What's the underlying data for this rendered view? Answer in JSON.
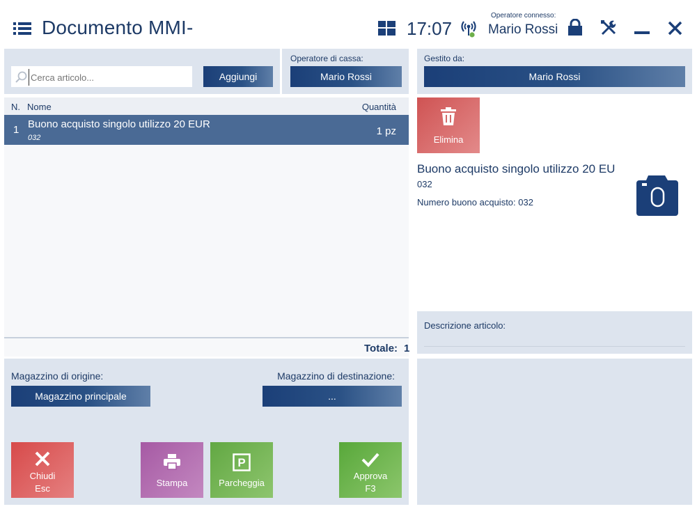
{
  "header": {
    "title": "Documento MMI-",
    "time": "17:07",
    "operator_caption": "Operatore connesso:",
    "operator_name": "Mario Rossi"
  },
  "search": {
    "placeholder": "Cerca articolo...",
    "add_label": "Aggiungi"
  },
  "cashier": {
    "label": "Operatore di cassa:",
    "value": "Mario Rossi"
  },
  "managed_by": {
    "label": "Gestito da:",
    "value": "Mario Rossi"
  },
  "table": {
    "col_n": "N.",
    "col_name": "Nome",
    "col_qty": "Quantità",
    "rows": [
      {
        "n": "1",
        "name": "Buono acquisto singolo utilizzo 20 EUR",
        "code": "032",
        "qty": "1 pz"
      }
    ],
    "total_label": "Totale:",
    "total_value": "1"
  },
  "warehouse": {
    "origin_label": "Magazzino di origine:",
    "origin_value": "Magazzino principale",
    "dest_label": "Magazzino di destinazione:",
    "dest_value": "..."
  },
  "actions": {
    "close_label": "Chiudi",
    "close_key": "Esc",
    "print_label": "Stampa",
    "park_label": "Parcheggia",
    "approve_label": "Approva",
    "approve_key": "F3"
  },
  "details": {
    "delete_label": "Elimina",
    "item_name": "Buono acquisto singolo utilizzo 20 EU",
    "item_code": "032",
    "voucher_label": "Numero buono acquisto: 032",
    "description_label": "Descrizione articolo:"
  },
  "colors": {
    "accent": "#1b3f78",
    "panel": "#dde4ee",
    "selected_row": "#4a6a95",
    "delete": "#d35b5b",
    "print": "#a866a6",
    "park": "#6daf4a",
    "approve": "#5fae3f"
  },
  "icons": {
    "menu": "hamburger-list-icon",
    "tiles": "tiles-icon",
    "connection": "antenna-icon",
    "lock": "lock-icon",
    "tools": "tools-icon",
    "minimize": "minimize-icon",
    "close": "close-icon",
    "search": "search-icon",
    "trash": "trash-icon",
    "camera": "camera-icon",
    "print": "printer-icon",
    "park": "parking-icon",
    "approve": "checkmark-icon"
  }
}
